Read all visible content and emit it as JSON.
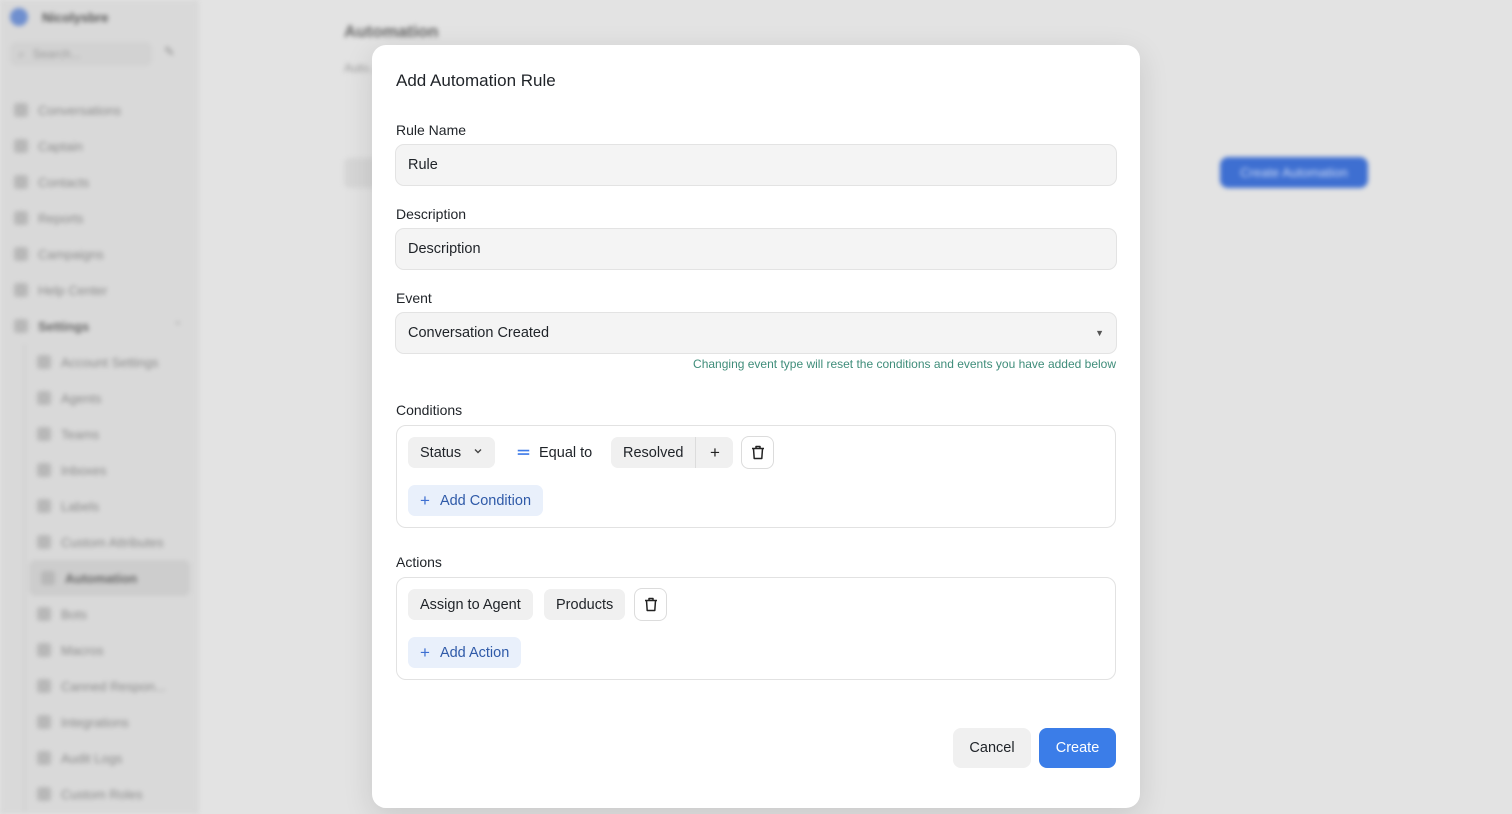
{
  "background": {
    "workspace_name": "Nicolysbre",
    "search_placeholder": "Search...",
    "nav": [
      {
        "label": "Conversations",
        "icon": "chat-icon"
      },
      {
        "label": "Captain",
        "icon": "captain-icon"
      },
      {
        "label": "Contacts",
        "icon": "contacts-icon"
      },
      {
        "label": "Reports",
        "icon": "reports-icon"
      },
      {
        "label": "Campaigns",
        "icon": "campaigns-icon"
      },
      {
        "label": "Help Center",
        "icon": "book-icon"
      }
    ],
    "settings_label": "Settings",
    "settings_items": [
      "Account Settings",
      "Agents",
      "Teams",
      "Inboxes",
      "Labels",
      "Custom Attributes",
      "Automation",
      "Bots",
      "Macros",
      "Canned Respon...",
      "Integrations",
      "Audit Logs",
      "Custom Roles"
    ],
    "active_settings_item": "Automation",
    "page_title": "Automation",
    "page_desc": "Auto...",
    "create_button": "Create Automation"
  },
  "modal": {
    "title": "Add Automation Rule",
    "rule_name": {
      "label": "Rule Name",
      "value": "Rule"
    },
    "description": {
      "label": "Description",
      "value": "Description"
    },
    "event": {
      "label": "Event",
      "value": "Conversation Created",
      "hint": "Changing event type will reset the conditions and events you have added below"
    },
    "conditions": {
      "label": "Conditions",
      "rows": [
        {
          "attribute": "Status",
          "operator": "Equal to",
          "value": "Resolved"
        }
      ],
      "add_label": "Add Condition"
    },
    "actions": {
      "label": "Actions",
      "rows": [
        {
          "action": "Assign to Agent",
          "value": "Products"
        }
      ],
      "add_label": "Add Action"
    },
    "cancel_label": "Cancel",
    "create_label": "Create"
  },
  "colors": {
    "primary": "#3b7de8",
    "hint": "#3f8d7a"
  }
}
